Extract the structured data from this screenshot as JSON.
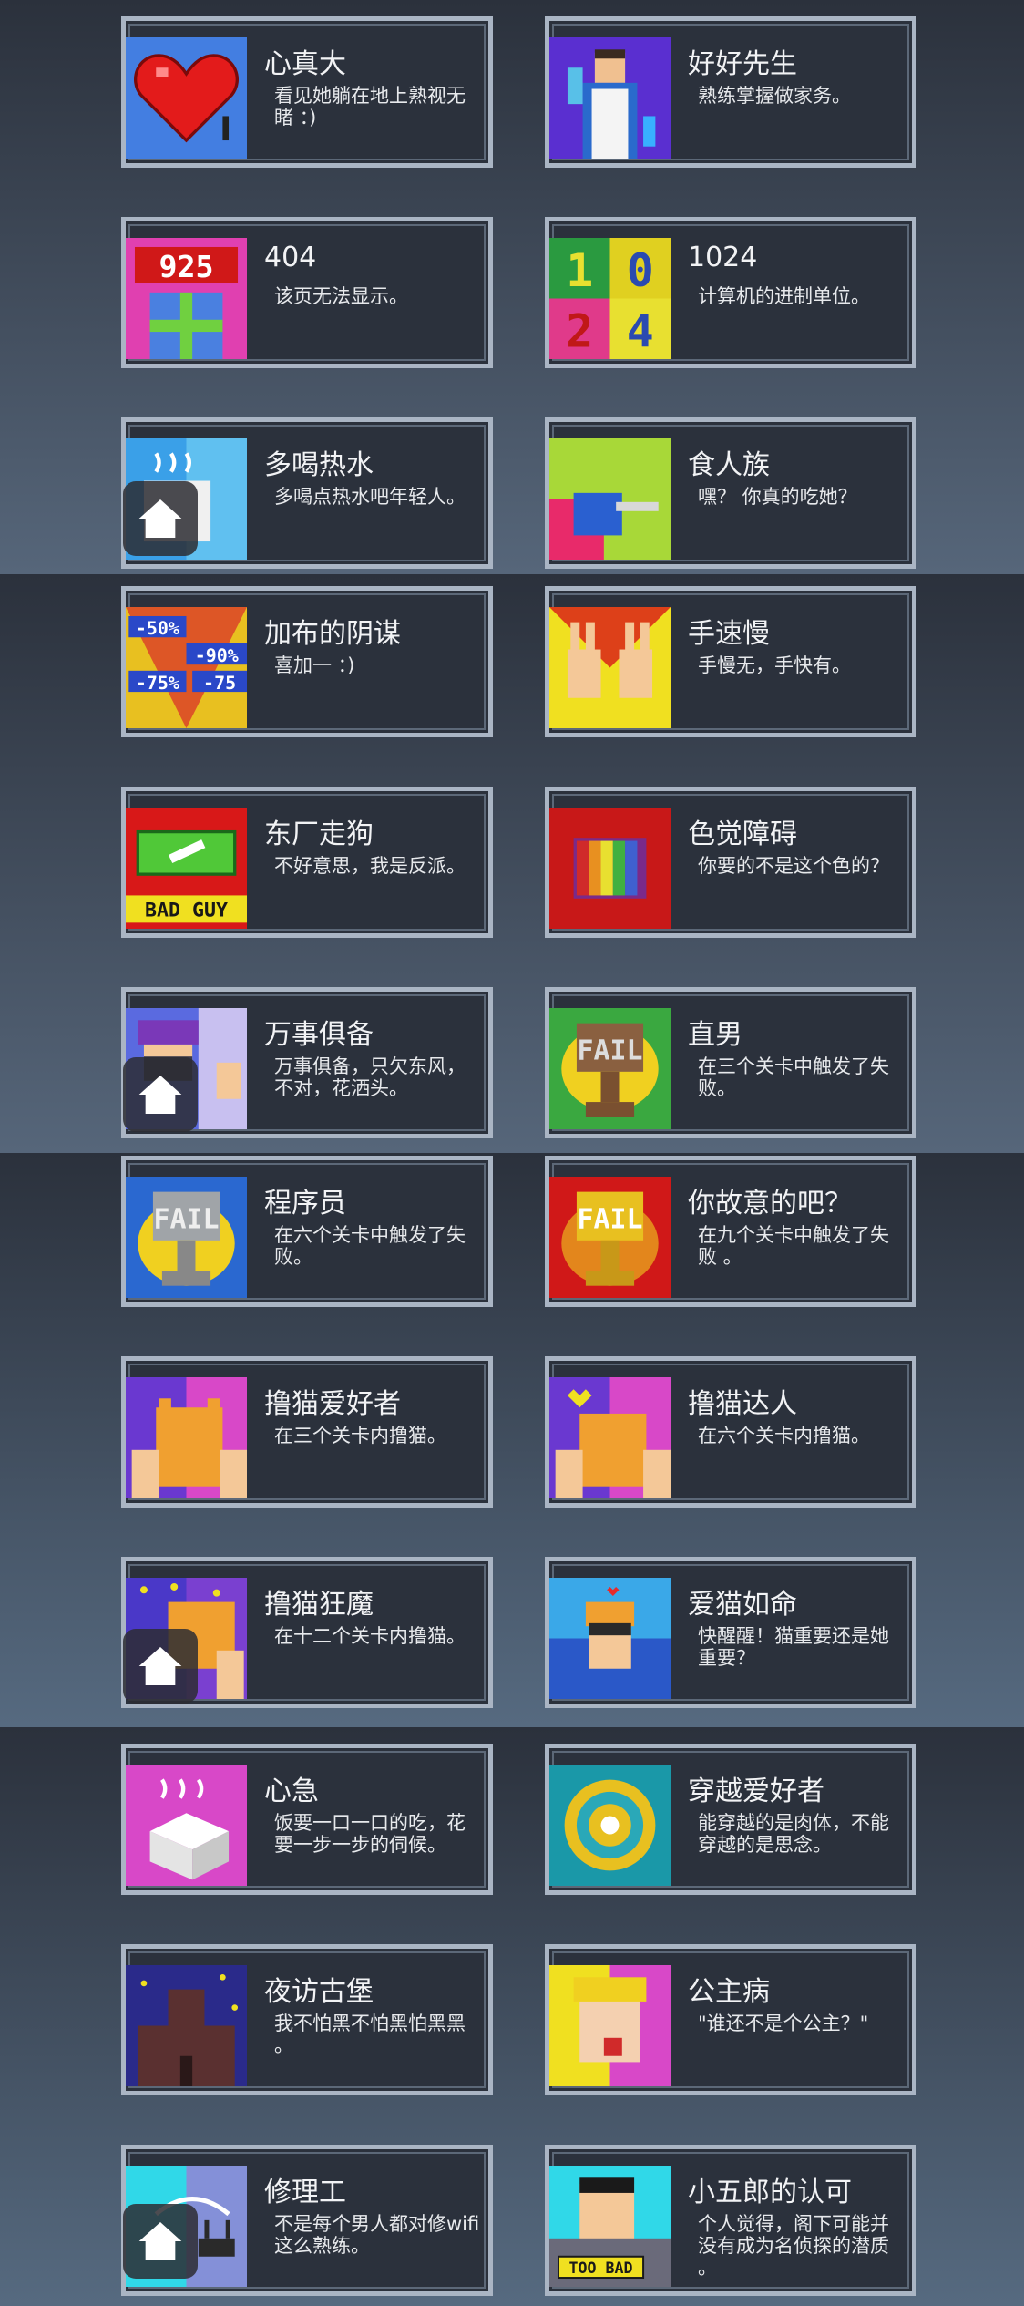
{
  "achievements": [
    {
      "title": "心真大",
      "desc": "看见她躺在地上熟视无睹 ：)",
      "icon": "heart-icon"
    },
    {
      "title": "好好先生",
      "desc": "熟练掌握做家务。",
      "icon": "housework-man-icon"
    },
    {
      "title": "404",
      "desc": "该页无法显示。",
      "icon": "gift-925-icon"
    },
    {
      "title": "1024",
      "desc": "计算机的进制单位。",
      "icon": "number-blocks-icon"
    },
    {
      "title": "多喝热水",
      "desc": "多喝点热水吧年轻人。",
      "icon": "hot-water-icon"
    },
    {
      "title": "食人族",
      "desc": "嘿？ 你真的吃她？",
      "icon": "cannibal-icon"
    },
    {
      "title": "加布的阴谋",
      "desc": "喜加一 ：)",
      "icon": "sale-tags-icon"
    },
    {
      "title": "手速慢",
      "desc": "手慢无，手快有。",
      "icon": "peace-hands-icon"
    },
    {
      "title": "东厂走狗",
      "desc": "不好意思，我是反派。",
      "icon": "bad-guy-icon"
    },
    {
      "title": "色觉障碍",
      "desc": "你要的不是这个色的？",
      "icon": "rainbow-blocks-icon"
    },
    {
      "title": "万事俱备",
      "desc": "万事俱备，只欠东风，不对，花洒头。",
      "icon": "ninja-ok-icon"
    },
    {
      "title": "直男",
      "desc": "在三个关卡中触发了失败。",
      "icon": "fail-trophy-bronze-icon"
    },
    {
      "title": "程序员",
      "desc": "在六个关卡中触发了失败。",
      "icon": "fail-trophy-silver-icon"
    },
    {
      "title": "你故意的吧？",
      "desc": "在九个关卡中触发了失败 。",
      "icon": "fail-trophy-gold-icon"
    },
    {
      "title": "撸猫爱好者",
      "desc": "在三个关卡内撸猫。",
      "icon": "cat-pet-icon"
    },
    {
      "title": "撸猫达人",
      "desc": "在六个关卡内撸猫。",
      "icon": "cat-pet-heart-icon"
    },
    {
      "title": "撸猫狂魔",
      "desc": "在十二个关卡内撸猫。",
      "icon": "cat-pet-stars-icon"
    },
    {
      "title": "爱猫如命",
      "desc": "快醒醒！猫重要还是她重要？",
      "icon": "cat-on-head-icon"
    },
    {
      "title": "心急",
      "desc": "饭要一口一口的吃，花要一步一步的伺候。",
      "icon": "tofu-icon"
    },
    {
      "title": "穿越爱好者",
      "desc": "能穿越的是肉体，不能穿越的是思念。",
      "icon": "portal-icon"
    },
    {
      "title": "夜访古堡",
      "desc": "我不怕黑不怕黑怕黑黑 。",
      "icon": "castle-icon"
    },
    {
      "title": "公主病",
      "desc": "\"谁还不是个公主？\"",
      "icon": "princess-icon"
    },
    {
      "title": "修理工",
      "desc": "不是每个男人都对修wifi这么熟练。",
      "icon": "wifi-router-icon"
    },
    {
      "title": "小五郎的认可",
      "desc": "个人觉得，阁下可能并没有成为名侦探的潜质 。",
      "icon": "too-bad-detective-icon"
    }
  ],
  "thumb_text": {
    "n925": "925",
    "bad_guy": "BAD GUY",
    "fail": "FAIL",
    "too_bad": "TOO BAD",
    "sale1": "-50%",
    "sale2": "-90%",
    "sale3": "-75%",
    "sale4": "-75",
    "num1": "1",
    "num0": "0",
    "num2": "2",
    "num4": "4"
  },
  "home_icon": "home-icon"
}
